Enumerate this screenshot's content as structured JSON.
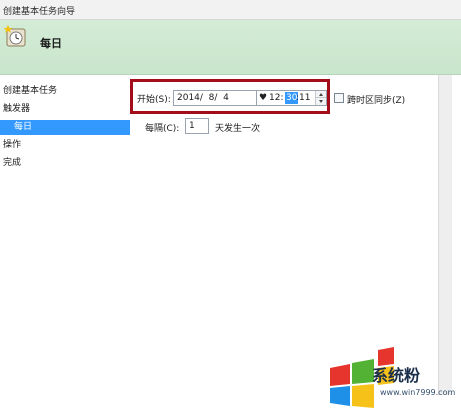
{
  "window": {
    "title": "创建基本任务向导"
  },
  "header": {
    "icon": "clock-wizard-icon",
    "title": "每日"
  },
  "nav": {
    "items": [
      {
        "label": "创建基本任务"
      },
      {
        "label": "触发器"
      },
      {
        "label": "每日",
        "selected": true
      },
      {
        "label": "操作"
      },
      {
        "label": "完成"
      }
    ]
  },
  "schedule": {
    "start_label": "开始(S):",
    "date_value": "2014/  8/  4",
    "time_hour": "12:",
    "time_minute": "30",
    "time_second": ":11",
    "sync_label": "跨时区同步(Z)",
    "sync_checked": false,
    "interval_label": "每隔(C):",
    "interval_value": "1",
    "interval_unit": "天发生一次"
  },
  "watermark": {
    "text": "系统粉",
    "url": "www.win7999.com"
  },
  "colors": {
    "header_bg": "#c9e5cc",
    "selection": "#3399ff",
    "highlight_border": "#a30d1a"
  }
}
